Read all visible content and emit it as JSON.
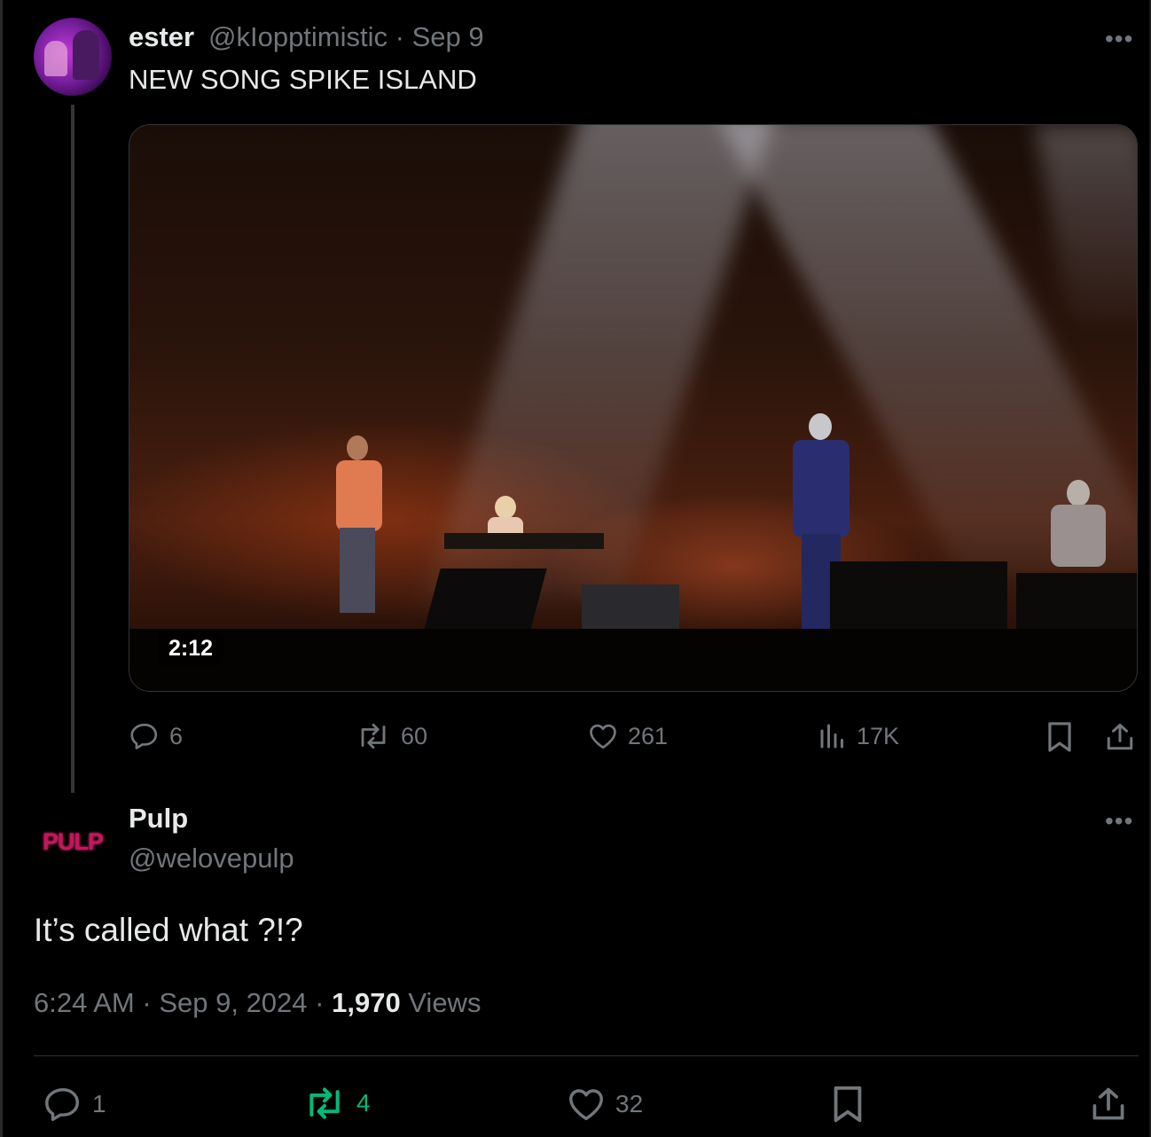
{
  "parent_tweet": {
    "display_name": "ester",
    "handle": "@kIopptimistic",
    "separator": "·",
    "date": "Sep 9",
    "text": "NEW SONG SPIKE ISLAND",
    "video_duration": "2:12",
    "more_icon": "more-horizontal-icon",
    "stats": {
      "replies": "6",
      "reposts": "60",
      "likes": "261",
      "views": "17K"
    }
  },
  "reply_tweet": {
    "avatar_text": "PULP",
    "display_name": "Pulp",
    "handle": "@welovepulp",
    "text": "It’s called what ?!?",
    "time": "6:24 AM",
    "sep1": "·",
    "date": "Sep 9, 2024",
    "sep2": "·",
    "views_count": "1,970",
    "views_label": "Views",
    "stats": {
      "replies": "1",
      "reposts": "4",
      "likes": "32"
    }
  },
  "colors": {
    "background": "#000000",
    "text_primary": "#e7e9ea",
    "text_secondary": "#71767b",
    "repost_active": "#00ba7c",
    "border": "#2f3336",
    "pulp_logo": "#c2185b"
  }
}
